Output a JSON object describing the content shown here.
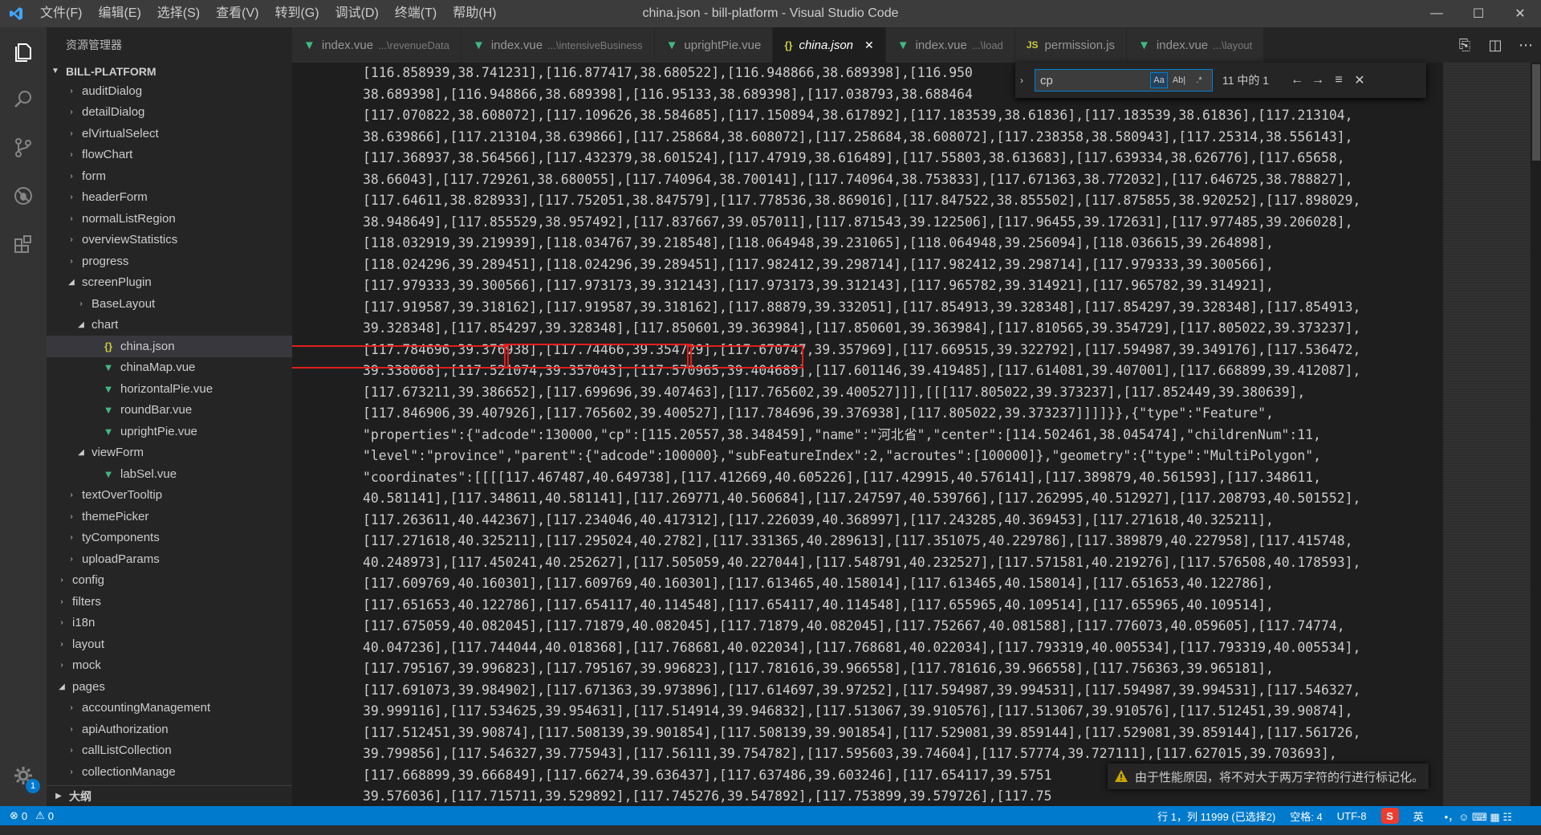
{
  "window": {
    "title": "china.json - bill-platform - Visual Studio Code",
    "menu": [
      "文件(F)",
      "编辑(E)",
      "选择(S)",
      "查看(V)",
      "转到(G)",
      "调试(D)",
      "终端(T)",
      "帮助(H)"
    ],
    "controls": {
      "minimize": "—",
      "maximize": "☐",
      "close": "✕"
    }
  },
  "activity_bar": {
    "items": [
      "files-icon",
      "search-icon",
      "source-control-icon",
      "debug-icon",
      "extensions-icon"
    ],
    "settings_badge": "1"
  },
  "sidebar": {
    "title": "资源管理器",
    "section": "BILL-PLATFORM",
    "tree": [
      {
        "label": "auditDialog",
        "depth": 3,
        "kind": "folder",
        "state": "collapsed"
      },
      {
        "label": "detailDialog",
        "depth": 3,
        "kind": "folder",
        "state": "collapsed"
      },
      {
        "label": "elVirtualSelect",
        "depth": 3,
        "kind": "folder",
        "state": "collapsed"
      },
      {
        "label": "flowChart",
        "depth": 3,
        "kind": "folder",
        "state": "collapsed"
      },
      {
        "label": "form",
        "depth": 3,
        "kind": "folder",
        "state": "collapsed"
      },
      {
        "label": "headerForm",
        "depth": 3,
        "kind": "folder",
        "state": "collapsed"
      },
      {
        "label": "normalListRegion",
        "depth": 3,
        "kind": "folder",
        "state": "collapsed"
      },
      {
        "label": "overviewStatistics",
        "depth": 3,
        "kind": "folder",
        "state": "collapsed"
      },
      {
        "label": "progress",
        "depth": 3,
        "kind": "folder",
        "state": "collapsed"
      },
      {
        "label": "screenPlugin",
        "depth": 3,
        "kind": "folder",
        "state": "expanded"
      },
      {
        "label": "BaseLayout",
        "depth": 4,
        "kind": "folder",
        "state": "collapsed"
      },
      {
        "label": "chart",
        "depth": 4,
        "kind": "folder",
        "state": "expanded"
      },
      {
        "label": "china.json",
        "depth": 5,
        "kind": "json",
        "state": "selected"
      },
      {
        "label": "chinaMap.vue",
        "depth": 5,
        "kind": "vue"
      },
      {
        "label": "horizontalPie.vue",
        "depth": 5,
        "kind": "vue"
      },
      {
        "label": "roundBar.vue",
        "depth": 5,
        "kind": "vue"
      },
      {
        "label": "uprightPie.vue",
        "depth": 5,
        "kind": "vue"
      },
      {
        "label": "viewForm",
        "depth": 4,
        "kind": "folder",
        "state": "expanded"
      },
      {
        "label": "labSel.vue",
        "depth": 5,
        "kind": "vue"
      },
      {
        "label": "textOverTooltip",
        "depth": 3,
        "kind": "folder",
        "state": "collapsed"
      },
      {
        "label": "themePicker",
        "depth": 3,
        "kind": "folder",
        "state": "collapsed"
      },
      {
        "label": "tyComponents",
        "depth": 3,
        "kind": "folder",
        "state": "collapsed"
      },
      {
        "label": "uploadParams",
        "depth": 3,
        "kind": "folder",
        "state": "collapsed"
      },
      {
        "label": "config",
        "depth": 2,
        "kind": "folder",
        "state": "collapsed"
      },
      {
        "label": "filters",
        "depth": 2,
        "kind": "folder",
        "state": "collapsed"
      },
      {
        "label": "i18n",
        "depth": 2,
        "kind": "folder",
        "state": "collapsed"
      },
      {
        "label": "layout",
        "depth": 2,
        "kind": "folder",
        "state": "collapsed"
      },
      {
        "label": "mock",
        "depth": 2,
        "kind": "folder",
        "state": "collapsed"
      },
      {
        "label": "pages",
        "depth": 2,
        "kind": "folder",
        "state": "expanded"
      },
      {
        "label": "accountingManagement",
        "depth": 3,
        "kind": "folder",
        "state": "collapsed"
      },
      {
        "label": "apiAuthorization",
        "depth": 3,
        "kind": "folder",
        "state": "collapsed"
      },
      {
        "label": "callListCollection",
        "depth": 3,
        "kind": "folder",
        "state": "collapsed"
      },
      {
        "label": "collectionManage",
        "depth": 3,
        "kind": "folder",
        "state": "collapsed"
      }
    ],
    "outline_label": "大纲"
  },
  "tabs": [
    {
      "label": "index.vue",
      "desc": "...\\revenueData",
      "icon": "vue"
    },
    {
      "label": "index.vue",
      "desc": "...\\intensiveBusiness",
      "icon": "vue"
    },
    {
      "label": "uprightPie.vue",
      "desc": "",
      "icon": "vue"
    },
    {
      "label": "china.json",
      "desc": "",
      "icon": "json",
      "active": true
    },
    {
      "label": "index.vue",
      "desc": "...\\load",
      "icon": "vue"
    },
    {
      "label": "permission.js",
      "desc": "",
      "icon": "js"
    },
    {
      "label": "index.vue",
      "desc": "...\\layout",
      "icon": "vue"
    }
  ],
  "editor": {
    "lines": [
      "[116.858939,38.741231],[116.877417,38.680522],[116.948866,38.689398],[116.950",
      "38.689398],[116.948866,38.689398],[116.95133,38.689398],[117.038793,38.688464",
      "[117.070822,38.608072],[117.109626,38.584685],[117.150894,38.617892],[117.183539,38.61836],[117.183539,38.61836],[117.213104,",
      "38.639866],[117.213104,38.639866],[117.258684,38.608072],[117.258684,38.608072],[117.238358,38.580943],[117.25314,38.556143],",
      "[117.368937,38.564566],[117.432379,38.601524],[117.47919,38.616489],[117.55803,38.613683],[117.639334,38.626776],[117.65658,",
      "38.66043],[117.729261,38.680055],[117.740964,38.700141],[117.740964,38.753833],[117.671363,38.772032],[117.646725,38.788827],",
      "[117.64611,38.828933],[117.752051,38.847579],[117.778536,38.869016],[117.847522,38.855502],[117.875855,38.920252],[117.898029,",
      "38.948649],[117.855529,38.957492],[117.837667,39.057011],[117.871543,39.122506],[117.96455,39.172631],[117.977485,39.206028],",
      "[118.032919,39.219939],[118.034767,39.218548],[118.064948,39.231065],[118.064948,39.256094],[118.036615,39.264898],",
      "[118.024296,39.289451],[118.024296,39.289451],[117.982412,39.298714],[117.982412,39.298714],[117.979333,39.300566],",
      "[117.979333,39.300566],[117.973173,39.312143],[117.973173,39.312143],[117.965782,39.314921],[117.965782,39.314921],",
      "[117.919587,39.318162],[117.919587,39.318162],[117.88879,39.332051],[117.854913,39.328348],[117.854297,39.328348],[117.854913,",
      "39.328348],[117.854297,39.328348],[117.850601,39.363984],[117.850601,39.363984],[117.810565,39.354729],[117.805022,39.373237],",
      "[117.784696,39.376938],[117.74466,39.354729],[117.670747,39.357969],[117.669515,39.322792],[117.594987,39.349176],[117.536472,",
      "39.338068],[117.521074,39.357043],[117.570965,39.404689],[117.601146,39.419485],[117.614081,39.407001],[117.668899,39.412087],",
      "[117.673211,39.386652],[117.699696,39.407463],[117.765602,39.400527]]],[[[117.805022,39.373237],[117.852449,39.380639],",
      "[117.846906,39.407926],[117.765602,39.400527],[117.784696,39.376938],[117.805022,39.373237]]]]}},{\"type\":\"Feature\",",
      "\"properties\":{\"adcode\":130000,\"cp\":[115.20557,38.348459],\"name\":\"河北省\",\"center\":[114.502461,38.045474],\"childrenNum\":11,",
      "\"level\":\"province\",\"parent\":{\"adcode\":100000},\"subFeatureIndex\":2,\"acroutes\":[100000]},\"geometry\":{\"type\":\"MultiPolygon\",",
      "\"coordinates\":[[[[117.467487,40.649738],[117.412669,40.605226],[117.429915,40.576141],[117.389879,40.561593],[117.348611,",
      "40.581141],[117.348611,40.581141],[117.269771,40.560684],[117.247597,40.539766],[117.262995,40.512927],[117.208793,40.501552],",
      "[117.263611,40.442367],[117.234046,40.417312],[117.226039,40.368997],[117.243285,40.369453],[117.271618,40.325211],",
      "[117.271618,40.325211],[117.295024,40.2782],[117.331365,40.289613],[117.351075,40.229786],[117.389879,40.227958],[117.415748,",
      "40.248973],[117.450241,40.252627],[117.505059,40.227044],[117.548791,40.232527],[117.571581,40.219276],[117.576508,40.178593],",
      "[117.609769,40.160301],[117.609769,40.160301],[117.613465,40.158014],[117.613465,40.158014],[117.651653,40.122786],",
      "[117.651653,40.122786],[117.654117,40.114548],[117.654117,40.114548],[117.655965,40.109514],[117.655965,40.109514],",
      "[117.675059,40.082045],[117.71879,40.082045],[117.71879,40.082045],[117.752667,40.081588],[117.776073,40.059605],[117.74774,",
      "40.047236],[117.744044,40.018368],[117.768681,40.022034],[117.768681,40.022034],[117.793319,40.005534],[117.793319,40.005534],",
      "[117.795167,39.996823],[117.795167,39.996823],[117.781616,39.966558],[117.781616,39.966558],[117.756363,39.965181],",
      "[117.691073,39.984902],[117.671363,39.973896],[117.614697,39.97252],[117.594987,39.994531],[117.594987,39.994531],[117.546327,",
      "39.999116],[117.534625,39.954631],[117.514914,39.946832],[117.513067,39.910576],[117.513067,39.910576],[117.512451,39.90874],",
      "[117.512451,39.90874],[117.508139,39.901854],[117.508139,39.901854],[117.529081,39.859144],[117.529081,39.859144],[117.561726,",
      "39.799856],[117.546327,39.775943],[117.56111,39.754782],[117.595603,39.74604],[117.57774,39.727111],[117.627015,39.703693],",
      "[117.668899,39.666849],[117.66274,39.636437],[117.637486,39.603246],[117.654117,39.5751",
      "39.576036],[117.715711,39.529892],[117.745276,39.547892],[117.753899,39.579726],[117.75"
    ]
  },
  "find_widget": {
    "query": "cp",
    "match_case_label": "Aa",
    "whole_word_label": "Ab|",
    "regex_label": ".*",
    "count": "11 中的 1",
    "prev_label": "←",
    "next_label": "→",
    "selection_label": "≡",
    "close_label": "✕"
  },
  "notification": {
    "text": "由于性能原因，将不对大于两万字符的行进行标记化。"
  },
  "status_bar": {
    "errors": "0",
    "warnings": "0",
    "position": "行 1，列 11999 (已选择2)",
    "spaces": "空格: 4",
    "encoding": "UTF-8",
    "ime_label": "英",
    "ime_extra": "•，☺ ⌨ ▦ ☷"
  }
}
